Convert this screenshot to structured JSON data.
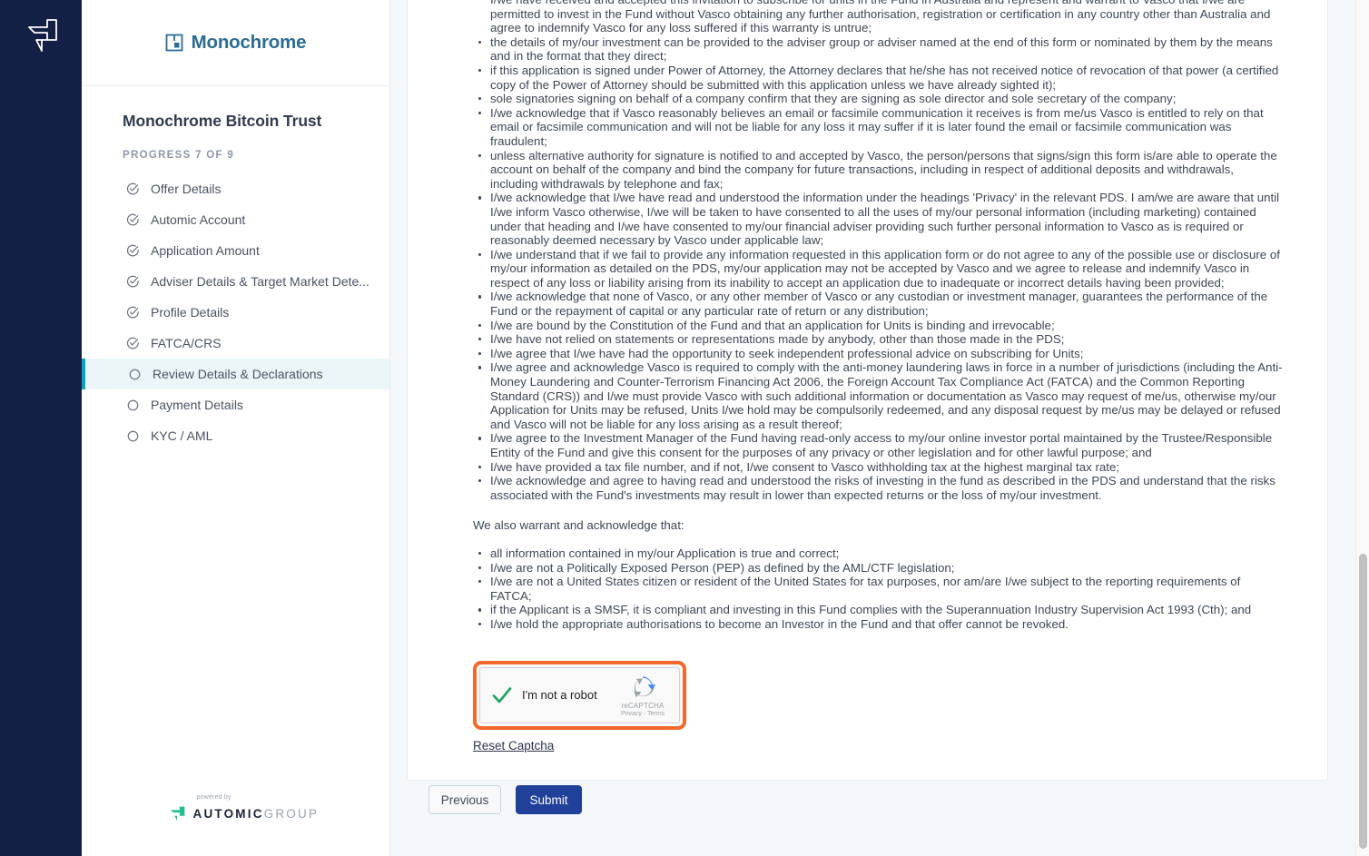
{
  "rail": {
    "logo_icon": "automic-arrow-logo"
  },
  "sidebar": {
    "brand": {
      "icon": "monochrome-square-icon",
      "name": "Monochrome"
    },
    "title": "Monochrome Bitcoin Trust",
    "progress_label": "PROGRESS 7 OF 9",
    "items": [
      {
        "label": "Offer Details",
        "icon": "check-circle-icon",
        "state": "complete"
      },
      {
        "label": "Automic Account",
        "icon": "check-circle-icon",
        "state": "complete"
      },
      {
        "label": "Application Amount",
        "icon": "check-circle-icon",
        "state": "complete"
      },
      {
        "label": "Adviser Details & Target Market Dete...",
        "icon": "check-circle-icon",
        "state": "complete"
      },
      {
        "label": "Profile Details",
        "icon": "check-circle-icon",
        "state": "complete"
      },
      {
        "label": "FATCA/CRS",
        "icon": "check-circle-icon",
        "state": "complete"
      },
      {
        "label": "Review Details & Declarations",
        "icon": "empty-circle-icon",
        "state": "active"
      },
      {
        "label": "Payment Details",
        "icon": "empty-circle-icon",
        "state": "pending"
      },
      {
        "label": "KYC / AML",
        "icon": "empty-circle-icon",
        "state": "pending"
      }
    ],
    "footer": {
      "powered_by": "powered by",
      "brand_bold": "AUTOMIC",
      "brand_light": "GROUP",
      "icon": "automic-group-mark"
    }
  },
  "declarations": {
    "items": [
      "I/we have received and accepted this invitation to subscribe for units in the Fund in Australia and represent and warrant to Vasco that I/we are permitted to invest in the Fund without Vasco obtaining any further authorisation, registration or certification in any country other than Australia and agree to indemnify Vasco for any loss suffered if this warranty is untrue;",
      "the details of my/our investment can be provided to the adviser group or adviser named at the end of this form or nominated by them by the means and in the format that they direct;",
      "if this application is signed under Power of Attorney, the Attorney declares that he/she has not received notice of revocation of that power (a certified copy of the Power of Attorney should be submitted with this application unless we have already sighted it);",
      "sole signatories signing on behalf of a company confirm that they are signing as sole director and sole secretary of the company;",
      "I/we acknowledge that if Vasco reasonably believes an email or facsimile communication it receives is from me/us Vasco is entitled to rely on that email or facsimile communication and will not be liable for any loss it may suffer if it is later found the email or facsimile communication was fraudulent;",
      "unless alternative authority for signature is notified to and accepted by Vasco, the person/persons that signs/sign this form is/are able to operate the account on behalf of the company and bind the company for future transactions, including in respect of additional deposits and withdrawals, including withdrawals by telephone and fax;",
      "I/we acknowledge that I/we have read and understood the information under the headings 'Privacy' in the relevant PDS. I am/we are aware that until I/we inform Vasco otherwise, I/we will be taken to have consented to all the uses of my/our personal information (including marketing) contained under that heading and I/we have consented to my/our financial adviser providing such further personal information to Vasco as is required or reasonably deemed necessary by Vasco under applicable law;",
      "I/we understand that if we fail to provide any information requested in this application form or do not agree to any of the possible use or disclosure of my/our information as detailed on the PDS, my/our application may not be accepted by Vasco and we agree to release and indemnify Vasco in respect of any loss or liability arising from its inability to accept an application due to inadequate or incorrect details having been provided;",
      "I/we acknowledge that none of Vasco, or any other member of Vasco or any custodian or investment manager, guarantees the performance of the Fund or the repayment of capital or any particular rate of return or any distribution;",
      "I/we are bound by the Constitution of the Fund and that an application for Units is binding and irrevocable;",
      "I/we have not relied on statements or representations made by anybody, other than those made in the PDS;",
      "I/we agree that I/we have had the opportunity to seek independent professional advice on subscribing for Units;",
      "I/we agree and acknowledge Vasco is required to comply with the anti-money laundering laws in force in a number of jurisdictions (including the Anti-Money Laundering and Counter-Terrorism Financing Act 2006, the Foreign Account Tax Compliance Act (FATCA) and the Common Reporting Standard (CRS)) and I/we must provide Vasco with such additional information or documentation as Vasco may request of me/us, otherwise my/our Application for Units may be refused, Units I/we hold may be compulsorily redeemed, and any disposal request by me/us may be delayed or refused and Vasco will not be liable for any loss arising as a result thereof;",
      "I/we agree to the Investment Manager of the Fund having read-only access to my/our online investor portal maintained by the Trustee/Responsible Entity of the Fund and give this consent for the purposes of any privacy or other legislation and for other lawful purpose; and",
      "I/we have provided a tax file number, and if not, I/we consent to Vasco withholding tax at the highest marginal tax rate;",
      "I/we acknowledge and agree to having read and understood the risks of investing in the fund as described in the PDS and understand that the risks associated with the Fund's investments may result in lower than expected returns or the loss of my/our investment."
    ],
    "warrant_lead": "We also warrant and acknowledge that:",
    "warrant_items": [
      "all information contained in my/our Application is true and correct;",
      "I/we are not a Politically Exposed Person (PEP) as defined by the AML/CTF legislation;",
      "I/we are not a United States citizen or resident of the United States for tax purposes, nor am/are I/we subject to the reporting requirements of FATCA;",
      "if the Applicant is a SMSF, it is compliant and investing in this Fund complies with the Superannuation Industry Supervision Act 1993 (Cth); and",
      "I/we hold the appropriate authorisations to become an Investor in the Fund and that offer cannot be revoked."
    ]
  },
  "captcha": {
    "checkbox_label": "I'm not a robot",
    "brand_name": "reCAPTCHA",
    "legal": "Privacy · Terms",
    "checked": true,
    "highlight_color": "#f4682c",
    "reset_link": "Reset Captcha"
  },
  "footer_actions": {
    "previous_label": "Previous",
    "submit_label": "Submit",
    "submit_color": "#21409a"
  }
}
